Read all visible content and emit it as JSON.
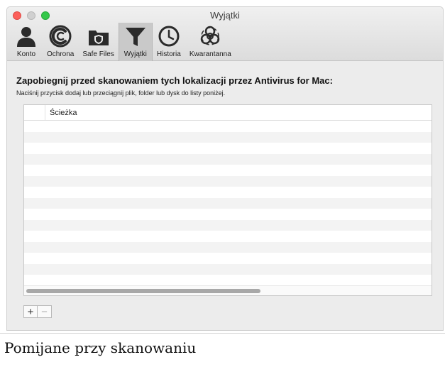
{
  "window": {
    "title": "Wyjątki"
  },
  "toolbar": {
    "items": [
      {
        "label": "Konto",
        "icon": "account-icon"
      },
      {
        "label": "Ochrona",
        "icon": "protection-icon"
      },
      {
        "label": "Safe Files",
        "icon": "safe-files-icon"
      },
      {
        "label": "Wyjątki",
        "icon": "exceptions-filter-icon",
        "active": true
      },
      {
        "label": "Historia",
        "icon": "history-clock-icon"
      },
      {
        "label": "Kwarantanna",
        "icon": "quarantine-biohazard-icon"
      }
    ]
  },
  "main": {
    "heading": "Zapobiegnij przed skanowaniem tych lokalizacji przez Antivirus for Mac:",
    "instruction": "Naciśnij przycisk dodaj lub przeciągnij plik, folder lub dysk do listy poniżej.",
    "table": {
      "column_path": "Ścieżka",
      "rows": []
    },
    "buttons": {
      "add": "+",
      "remove": "−"
    }
  },
  "caption": "Pomijane przy skanowaniu"
}
